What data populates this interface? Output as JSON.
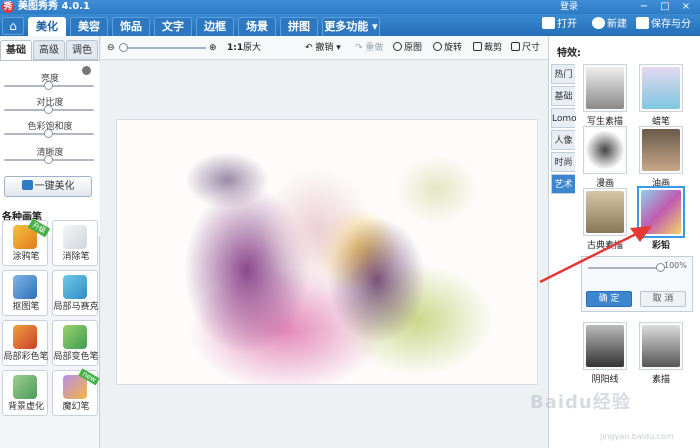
{
  "window": {
    "title": "美图秀秀 4.0.1",
    "logo_char": "秀",
    "login": "登录",
    "controls": [
      "−",
      "□",
      "×"
    ]
  },
  "menu": {
    "home_icon": "home-icon",
    "tabs": [
      {
        "label": "美化",
        "active": true
      },
      {
        "label": "美容",
        "active": false
      },
      {
        "label": "饰品",
        "active": false
      },
      {
        "label": "文字",
        "active": false
      },
      {
        "label": "边框",
        "active": false
      },
      {
        "label": "场景",
        "active": false
      },
      {
        "label": "拼图",
        "active": false
      },
      {
        "label": "更多功能 ▾",
        "active": false
      }
    ],
    "open": "打开",
    "new": "新建",
    "save_share": "保存与分享"
  },
  "left": {
    "tabs": [
      "基础",
      "高级",
      "调色"
    ],
    "adjust": [
      "亮度",
      "对比度",
      "色彩饱和度",
      "清晰度"
    ],
    "one_click": "一键美化",
    "brushes_title": "各种画笔",
    "tools": [
      {
        "label": "涂鸦笔",
        "flag": "升级"
      },
      {
        "label": "消除笔",
        "flag": ""
      },
      {
        "label": "抠图笔",
        "flag": ""
      },
      {
        "label": "局部马赛克",
        "flag": ""
      },
      {
        "label": "局部彩色笔",
        "flag": ""
      },
      {
        "label": "局部变色笔",
        "flag": ""
      },
      {
        "label": "背景虚化",
        "flag": ""
      },
      {
        "label": "魔幻笔",
        "flag": "new"
      }
    ]
  },
  "toolbar": {
    "zoom_ratio": "1:1",
    "original_size": "原大",
    "undo": "撤销 ▾",
    "redo": "重做",
    "original": "原图",
    "rotate": "旋转",
    "crop": "裁剪",
    "size": "尺寸"
  },
  "effects": {
    "title": "特效:",
    "categories": [
      {
        "label": "热门",
        "active": false
      },
      {
        "label": "基础",
        "active": false
      },
      {
        "label": "Lomo",
        "active": false
      },
      {
        "label": "人像",
        "active": false
      },
      {
        "label": "时尚",
        "active": false
      },
      {
        "label": "艺术",
        "active": true
      }
    ],
    "items": [
      "写生素描",
      "蜡笔",
      "漫画",
      "油画",
      "古典素描",
      "彩铅",
      "阴阳线",
      "素描"
    ],
    "selected": "彩铅",
    "strength_label": "100%",
    "strength": 1.0,
    "ok": "确 定",
    "cancel": "取 消"
  },
  "watermark": {
    "text": "Baidu经验",
    "url": "jingyan.baidu.com"
  },
  "colors": {
    "title_bar": "#2f7cc6",
    "accent": "#3b86cf",
    "arrow": "#e53935"
  }
}
